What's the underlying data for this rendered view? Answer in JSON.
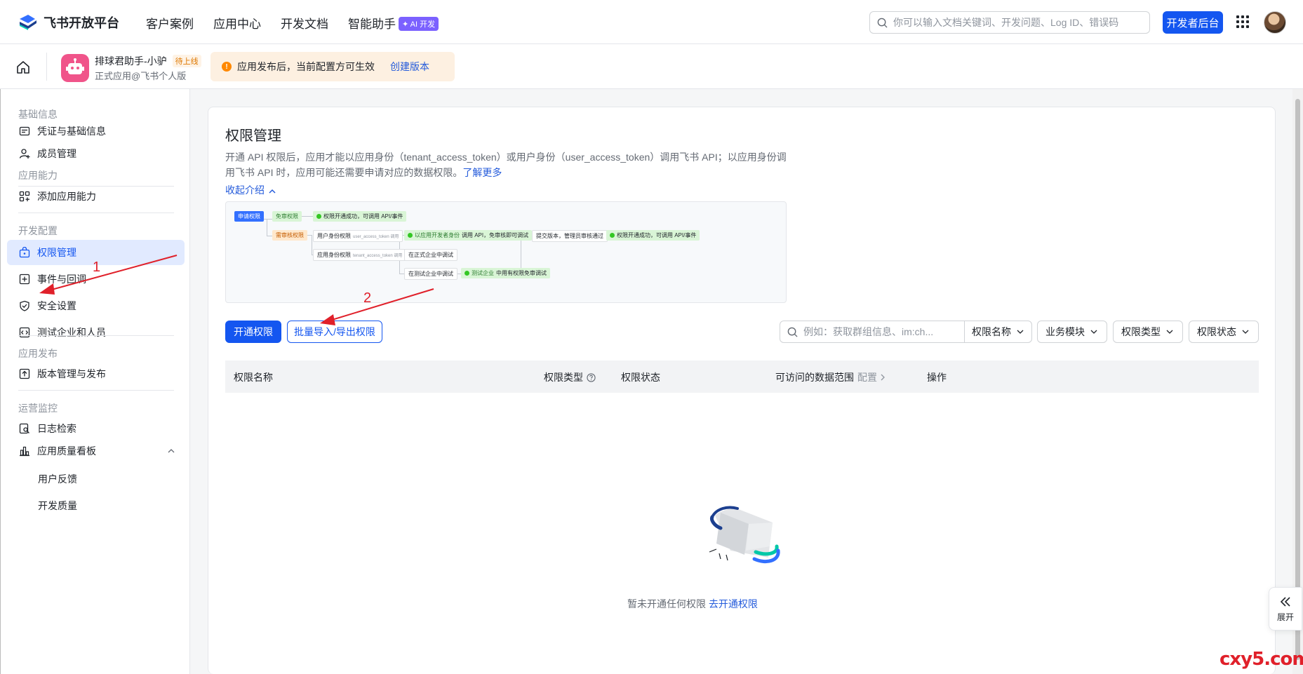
{
  "topbar": {
    "logo_text": "飞书开放平台",
    "nav": [
      "客户案例",
      "应用中心",
      "开发文档",
      "智能助手"
    ],
    "ai_badge": "✦ AI 开发",
    "search_placeholder": "你可以输入文档关键词、开发问题、Log ID、错误码",
    "dev_console": "开发者后台"
  },
  "appbar": {
    "app_name": "排球君助手-小驴",
    "status_badge": "待上线",
    "app_subtitle": "正式应用@飞书个人版",
    "notice_text": "应用发布后，当前配置方可生效",
    "notice_link": "创建版本"
  },
  "sidebar": {
    "sections": [
      {
        "title": "基础信息",
        "items": [
          "凭证与基础信息",
          "成员管理"
        ]
      },
      {
        "title": "应用能力",
        "items": [
          "添加应用能力"
        ]
      },
      {
        "title": "开发配置",
        "items": [
          "权限管理",
          "事件与回调",
          "安全设置",
          "测试企业和人员"
        ]
      },
      {
        "title": "应用发布",
        "items": [
          "版本管理与发布"
        ]
      },
      {
        "title": "运营监控",
        "items": [
          "日志检索",
          "应用质量看板"
        ]
      }
    ],
    "sub_items": [
      "用户反馈",
      "开发质量"
    ]
  },
  "main": {
    "title": "权限管理",
    "desc_1": "开通 API 权限后，应用才能以应用身份（tenant_access_token）或用户身份（user_access_token）调用飞书 API；以应用身份调",
    "desc_2": "用飞书 API 时，应用可能还需要申请对应的数据权限。",
    "learn_more": "了解更多",
    "collapse": "收起介绍",
    "flow": {
      "apply": "申请权限",
      "free": "免审权限",
      "review": "需审核权限",
      "success_1": "权限开通成功，可调用 API/事件",
      "user_perm": "用户身份权限",
      "user_token": "user_access_token 调用",
      "app_dev": "以应用开发者身份",
      "app_dev_suffix": "调用 API，免审核即可调试",
      "submit": "提交版本，管理员审核通过",
      "success_2": "权限开通成功，可调用 API/事件",
      "app_perm": "应用身份权限",
      "tenant_token": "tenant_access_token 调用",
      "prod_debug": "在正式企业中调试",
      "test_debug": "在测试企业中调试",
      "test_hl": "测试企业",
      "test_suffix": "中用有权限免审调试"
    },
    "btn_open": "开通权限",
    "btn_batch": "批量导入/导出权限",
    "filter_placeholder": "例如：获取群组信息、im:ch...",
    "filter_select": "权限名称",
    "filters": [
      "业务模块",
      "权限类型",
      "权限状态"
    ],
    "columns": {
      "name": "权限名称",
      "type": "权限类型",
      "status": "权限状态",
      "scope": "可访问的数据范围",
      "config": "配置",
      "ops": "操作"
    },
    "empty_text": "暂未开通任何权限",
    "empty_link": "去开通权限"
  },
  "expand_label": "展开",
  "annotations": [
    "1",
    "2"
  ],
  "watermark": "cxy5.com",
  "colors": {
    "primary": "#1456f0",
    "arrow": "#e0202a",
    "active_bg": "#e1eaff"
  }
}
